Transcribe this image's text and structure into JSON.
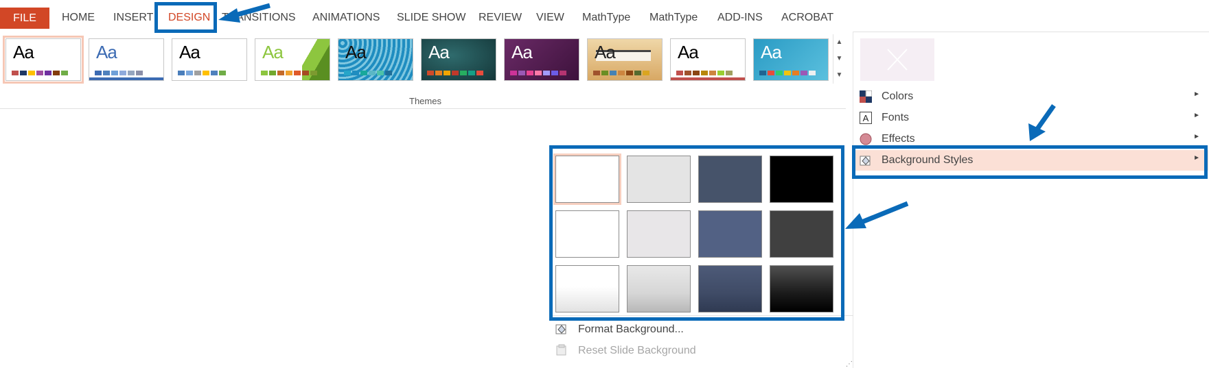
{
  "tabs": {
    "file": "FILE",
    "home": "HOME",
    "insert": "INSERT",
    "design": "DESIGN",
    "transitions": "TRANSITIONS",
    "animations": "ANIMATIONS",
    "slideshow": "SLIDE SHOW",
    "review": "REVIEW",
    "view": "VIEW",
    "mathtype1": "MathType",
    "mathtype2": "MathType",
    "addins": "ADD-INS",
    "acrobat": "ACROBAT"
  },
  "ribbon": {
    "group_label": "Themes",
    "theme_sample_text": "Aa",
    "themes": [
      {
        "name": "office-theme",
        "bg": "#ffffff",
        "text": "#000000",
        "colors": [
          "#c0504d",
          "#1f3864",
          "#ffc000",
          "#a04ea0",
          "#7030a0",
          "#843c0c",
          "#70ad47"
        ],
        "bar": ""
      },
      {
        "name": "facet",
        "bg": "#ffffff",
        "text": "#3c6bb3",
        "colors": [
          "#3c6bb3",
          "#4f81bd",
          "#6fa0d8",
          "#8faadc",
          "#95a5bf",
          "#8b8fa8"
        ],
        "bar": "#3c6bb3"
      },
      {
        "name": "integral",
        "bg": "#ffffff",
        "text": "#000000",
        "colors": [
          "#4a7ebb",
          "#7aa7dd",
          "#a0a0a0",
          "#ffc000",
          "#4f81bd",
          "#70ad47"
        ],
        "bar": ""
      },
      {
        "name": "ion-boardroom",
        "bg": "#ffffff",
        "text": "#8dc63f",
        "colors": [
          "#8dc63f",
          "#72a82e",
          "#c46a2a",
          "#f0a22e",
          "#e05a2a",
          "#a54b22",
          "#7d9a30"
        ],
        "bar": ""
      },
      {
        "name": "organic",
        "bg": "#1f8dc0",
        "text": "#111111",
        "colors": [
          "#26a5c9",
          "#1f8dc0",
          "#17a89b",
          "#5ab7c5",
          "#4dc1a8",
          "#1e6f9a"
        ],
        "bar": ""
      },
      {
        "name": "retrospect",
        "bg": "#1d4d4f",
        "text": "#ffffff",
        "colors": [
          "#d04a2a",
          "#e67e22",
          "#f0a500",
          "#c0392b",
          "#27ae60",
          "#16a085",
          "#e74c3c"
        ],
        "bar": ""
      },
      {
        "name": "slice",
        "bg": "#5a2359",
        "text": "#ffffff",
        "colors": [
          "#cc3399",
          "#9b59b6",
          "#e84393",
          "#fd79a8",
          "#a29bfe",
          "#6c5ce7",
          "#b53471"
        ],
        "bar": ""
      },
      {
        "name": "wisp",
        "bg": "#e8c48a",
        "text": "#222222",
        "colors": [
          "#a0522d",
          "#6b8e23",
          "#4682b4",
          "#cd853f",
          "#8b4513",
          "#556b2f",
          "#daa520"
        ],
        "bar": ""
      },
      {
        "name": "berlin",
        "bg": "#ffffff",
        "text": "#000000",
        "colors": [
          "#c0504d",
          "#a0522d",
          "#8b4513",
          "#b8860b",
          "#cd853f",
          "#9acd32",
          "#a0a060"
        ],
        "bar": "#c0504d"
      },
      {
        "name": "frame",
        "bg": "#2fa3c8",
        "text": "#ffffff",
        "colors": [
          "#1f6391",
          "#e74c3c",
          "#2ecc71",
          "#f1c40f",
          "#e67e22",
          "#9b59b6",
          "#ecf0f1"
        ],
        "bar": ""
      }
    ]
  },
  "variants_menu": {
    "colors": "Colors",
    "fonts": "Fonts",
    "effects": "Effects",
    "background_styles": "Background Styles"
  },
  "background_styles": {
    "cells": [
      "#ffffff",
      "#e4e4e4",
      "#46536a",
      "#000000",
      "#ffffff",
      "#e8e6e8",
      "#526184",
      "#404040",
      "gradient-white",
      "gradient-gray",
      "gradient-navy",
      "gradient-black"
    ],
    "format_background": "Format Background...",
    "reset_slide_background": "Reset Slide Background"
  },
  "colors": {
    "accent": "#d24726",
    "annotation": "#0a6ab8",
    "highlight": "#fbe0d6"
  }
}
